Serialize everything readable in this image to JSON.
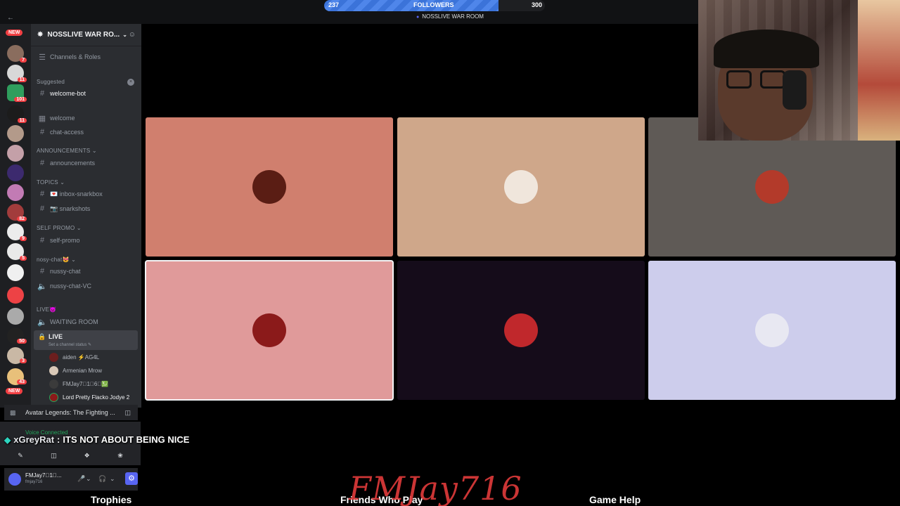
{
  "followers": {
    "current": "237",
    "label": "FOLLOWERS",
    "goal": "300",
    "progress": 0.79
  },
  "room_title": "NOSSLIVE WAR ROOM",
  "server": {
    "name": "NOSSLIVE WAR RO...",
    "channels_roles": "Channels & Roles"
  },
  "rail": {
    "new_top": "NEW",
    "new_bottom": "NEW",
    "badges": [
      "7",
      "11",
      "101",
      "11",
      "82",
      "9",
      "5",
      "50",
      "3",
      "43"
    ]
  },
  "sidebar": {
    "suggested_label": "Suggested",
    "suggested_channel": "welcome-bot",
    "channels_top": [
      "welcome",
      "chat-access"
    ],
    "cat_announcements": "ANNOUNCEMENTS",
    "announcements": "announcements",
    "cat_topics": "TOPICS",
    "topics": [
      "💌 inbox-snarkbox",
      "📷 snarkshots"
    ],
    "cat_selfpromo": "SELF PROMO",
    "selfpromo": "self-promo",
    "cat_nosy": "nosy-chat😻",
    "nosy": [
      "nussy-chat",
      "nussy-chat-VC"
    ],
    "cat_live": "LIVE👿",
    "waiting_room": "WAITING ROOM",
    "live_channel": "LIVE",
    "live_status": "Set a channel status ✎",
    "voice_users": [
      "aiden ⚡AG4L",
      "Armenian Mrow",
      "FMJay7⃣1⃣6⃣💹",
      "Lord Pretty Flacko Jodye 2"
    ]
  },
  "activity": {
    "name": "Avatar Legends: The Fighting ..."
  },
  "voice": {
    "status": "Voice Connected"
  },
  "user": {
    "name": "FMJay7⃣1⃣...",
    "tag": "fmjay716"
  },
  "chat_overlay": {
    "username": "xGreyRat",
    "separator": ":",
    "message": "ITS NOT ABOUT BEING NICE"
  },
  "signature": "FMJay716",
  "bottom_labels": [
    "Trophies",
    "Friends Who Play",
    "Game Help"
  ],
  "tiles": [
    {
      "bg": "#d07f6e",
      "avatar": "#5a1d14"
    },
    {
      "bg": "#cfa78a",
      "avatar": "#f0e6dc"
    },
    {
      "bg": "#5f5a56",
      "avatar": "#b33a2a"
    },
    {
      "bg": "#e09a9a",
      "avatar": "#8b1a1a"
    },
    {
      "bg": "#150c1a",
      "avatar": "#c0282c"
    },
    {
      "bg": "#cdcdec",
      "avatar": "#e8e8f2"
    }
  ]
}
